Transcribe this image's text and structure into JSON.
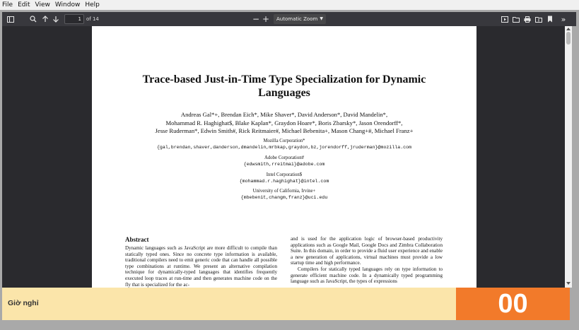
{
  "menu": [
    "File",
    "Edit",
    "View",
    "Window",
    "Help"
  ],
  "toolbar": {
    "page_number": "1",
    "page_count": "of 14",
    "zoom_label": "Automatic Zoom",
    "icons": [
      "sidebar-toggle-icon",
      "search-icon",
      "prev-page-icon",
      "next-page-icon",
      "zoom-out-icon",
      "zoom-in-icon",
      "presentation-icon",
      "open-file-icon",
      "print-icon",
      "save-icon",
      "bookmark-icon",
      "more-tools-icon"
    ]
  },
  "paper": {
    "title_line1": "Trace-based Just-in-Time Type Specialization for Dynamic",
    "title_line2": "Languages",
    "authors_line1": "Andreas Gal*+, Brendan Eich*, Mike Shaver*, David Anderson*, David Mandelin*,",
    "authors_line2": "Mohammad R. Haghighat$, Blake Kaplan*, Graydon Hoare*, Boris Zbarsky*, Jason Orendorff*,",
    "authors_line3": "Jesse Ruderman*, Edwin Smith#, Rick Reitmaier#, Michael Bebenita+, Mason Chang+#, Michael Franz+",
    "affil1_name": "Mozilla Corporation*",
    "affil1_email": "{gal,brendan,shaver,danderson,dmandelin,mrbkap,graydon,bz,jorendorff,jruderman}@mozilla.com",
    "affil2_name": "Adobe Corporation#",
    "affil2_email": "{edwsmith,rreitmai}@adobe.com",
    "affil3_name": "Intel Corporation$",
    "affil3_email": "{mohammad.r.haghighat}@intel.com",
    "affil4_name": "University of California, Irvine+",
    "affil4_email": "{mbebenit,changm,franz}@uci.edu",
    "abstract_heading": "Abstract",
    "abstract_text": "Dynamic languages such as JavaScript are more difficult to compile than statically typed ones. Since no concrete type information is available, traditional compilers need to emit generic code that can handle all possible type combinations at runtime. We present an alternative compilation technique for dynamically-typed languages that identifies frequently executed loop traces at run-time and then generates machine code on the fly that is specialized for the ac-",
    "right_col_p1": "and is used for the application logic of browser-based productivity applications such as Google Mail, Google Docs and Zimbra Collaboration Suite. In this domain, in order to provide a fluid user experience and enable a new generation of applications, virtual machines must provide a low startup time and high performance.",
    "right_col_p2": "Compilers for statically typed languages rely on type information to generate efficient machine code. In a dynamically typed programming language such as JavaScript, the types of expressions"
  },
  "banner": {
    "label": "Giờ nghỉ",
    "counter": "00",
    "label_bg": "#fbe5aa",
    "counter_bg": "#f27a2a"
  }
}
